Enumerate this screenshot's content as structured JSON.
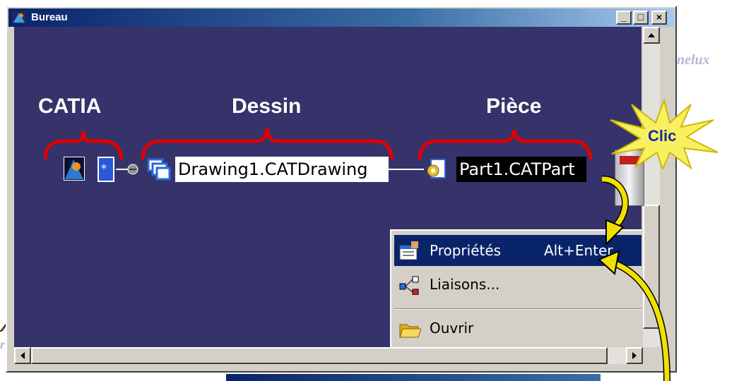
{
  "window": {
    "title": "Bureau",
    "controls": {
      "minimize": "_",
      "maximize": "□",
      "close": "×"
    }
  },
  "background_text": {
    "right": "nelux",
    "left": "r l"
  },
  "annotations": {
    "catia_label": "CATIA",
    "dessin_label": "Dessin",
    "piece_label": "Pièce",
    "clic_label": "Clic"
  },
  "nodes": {
    "drawing": "Drawing1.CATDrawing",
    "part": "Part1.CATPart"
  },
  "context_menu": {
    "items": [
      {
        "label": "Propriétés",
        "shortcut": "Alt+Enter",
        "highlighted": true
      },
      {
        "label": "Liaisons...",
        "shortcut": "",
        "highlighted": false
      },
      {
        "label": "Ouvrir",
        "shortcut": "",
        "highlighted": false
      }
    ]
  },
  "colors": {
    "desktop_bg": "#35336a",
    "brace_red": "#e00000",
    "arrow_yellow": "#f0e000",
    "menu_highlight": "#0a246a"
  }
}
